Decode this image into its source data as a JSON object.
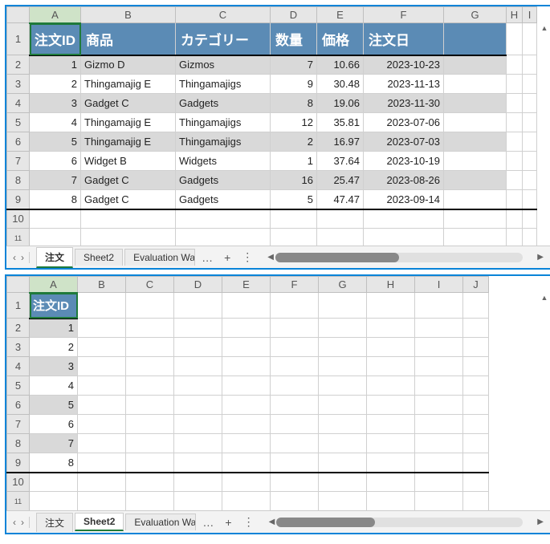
{
  "workbook1": {
    "columns": [
      "A",
      "B",
      "C",
      "D",
      "E",
      "F",
      "G",
      "H",
      "I"
    ],
    "headers": {
      "order_id": "注文ID",
      "product": "商品",
      "category": "カテゴリー",
      "qty": "数量",
      "price": "価格",
      "date": "注文日"
    },
    "rows": [
      {
        "id": "1",
        "product": "Gizmo D",
        "category": "Gizmos",
        "qty": "7",
        "price": "10.66",
        "date": "2023-10-23"
      },
      {
        "id": "2",
        "product": "Thingamajig E",
        "category": "Thingamajigs",
        "qty": "9",
        "price": "30.48",
        "date": "2023-11-13"
      },
      {
        "id": "3",
        "product": "Gadget C",
        "category": "Gadgets",
        "qty": "8",
        "price": "19.06",
        "date": "2023-11-30"
      },
      {
        "id": "4",
        "product": "Thingamajig E",
        "category": "Thingamajigs",
        "qty": "12",
        "price": "35.81",
        "date": "2023-07-06"
      },
      {
        "id": "5",
        "product": "Thingamajig E",
        "category": "Thingamajigs",
        "qty": "2",
        "price": "16.97",
        "date": "2023-07-03"
      },
      {
        "id": "6",
        "product": "Widget B",
        "category": "Widgets",
        "qty": "1",
        "price": "37.64",
        "date": "2023-10-19"
      },
      {
        "id": "7",
        "product": "Gadget C",
        "category": "Gadgets",
        "qty": "16",
        "price": "25.47",
        "date": "2023-08-26"
      },
      {
        "id": "8",
        "product": "Gadget C",
        "category": "Gadgets",
        "qty": "5",
        "price": "47.47",
        "date": "2023-09-14"
      }
    ],
    "blank_rows": [
      "10",
      "11"
    ],
    "tabs": {
      "t1": "注文",
      "t2": "Sheet2",
      "t3": "Evaluation Wa"
    },
    "active_tab": "注文",
    "selected_cell": "A1",
    "scroll_thumb_width_pct": 50
  },
  "workbook2": {
    "columns": [
      "A",
      "B",
      "C",
      "D",
      "E",
      "F",
      "G",
      "H",
      "I",
      "J"
    ],
    "headers": {
      "order_id": "注文ID"
    },
    "rows": [
      {
        "id": "1"
      },
      {
        "id": "2"
      },
      {
        "id": "3"
      },
      {
        "id": "4"
      },
      {
        "id": "5"
      },
      {
        "id": "6"
      },
      {
        "id": "7"
      },
      {
        "id": "8"
      }
    ],
    "blank_rows": [
      "10",
      "11"
    ],
    "tabs": {
      "t1": "注文",
      "t2": "Sheet2",
      "t3": "Evaluation Wa"
    },
    "active_tab": "Sheet2",
    "selected_cell": "A1",
    "scroll_thumb_width_pct": 40
  },
  "chart_data": {
    "type": "table",
    "title": "注文",
    "columns": [
      "注文ID",
      "商品",
      "カテゴリー",
      "数量",
      "価格",
      "注文日"
    ],
    "rows": [
      [
        1,
        "Gizmo D",
        "Gizmos",
        7,
        10.66,
        "2023-10-23"
      ],
      [
        2,
        "Thingamajig E",
        "Thingamajigs",
        9,
        30.48,
        "2023-11-13"
      ],
      [
        3,
        "Gadget C",
        "Gadgets",
        8,
        19.06,
        "2023-11-30"
      ],
      [
        4,
        "Thingamajig E",
        "Thingamajigs",
        12,
        35.81,
        "2023-07-06"
      ],
      [
        5,
        "Thingamajig E",
        "Thingamajigs",
        2,
        16.97,
        "2023-07-03"
      ],
      [
        6,
        "Widget B",
        "Widgets",
        1,
        37.64,
        "2023-10-19"
      ],
      [
        7,
        "Gadget C",
        "Gadgets",
        16,
        25.47,
        "2023-08-26"
      ],
      [
        8,
        "Gadget C",
        "Gadgets",
        5,
        47.47,
        "2023-09-14"
      ]
    ]
  }
}
